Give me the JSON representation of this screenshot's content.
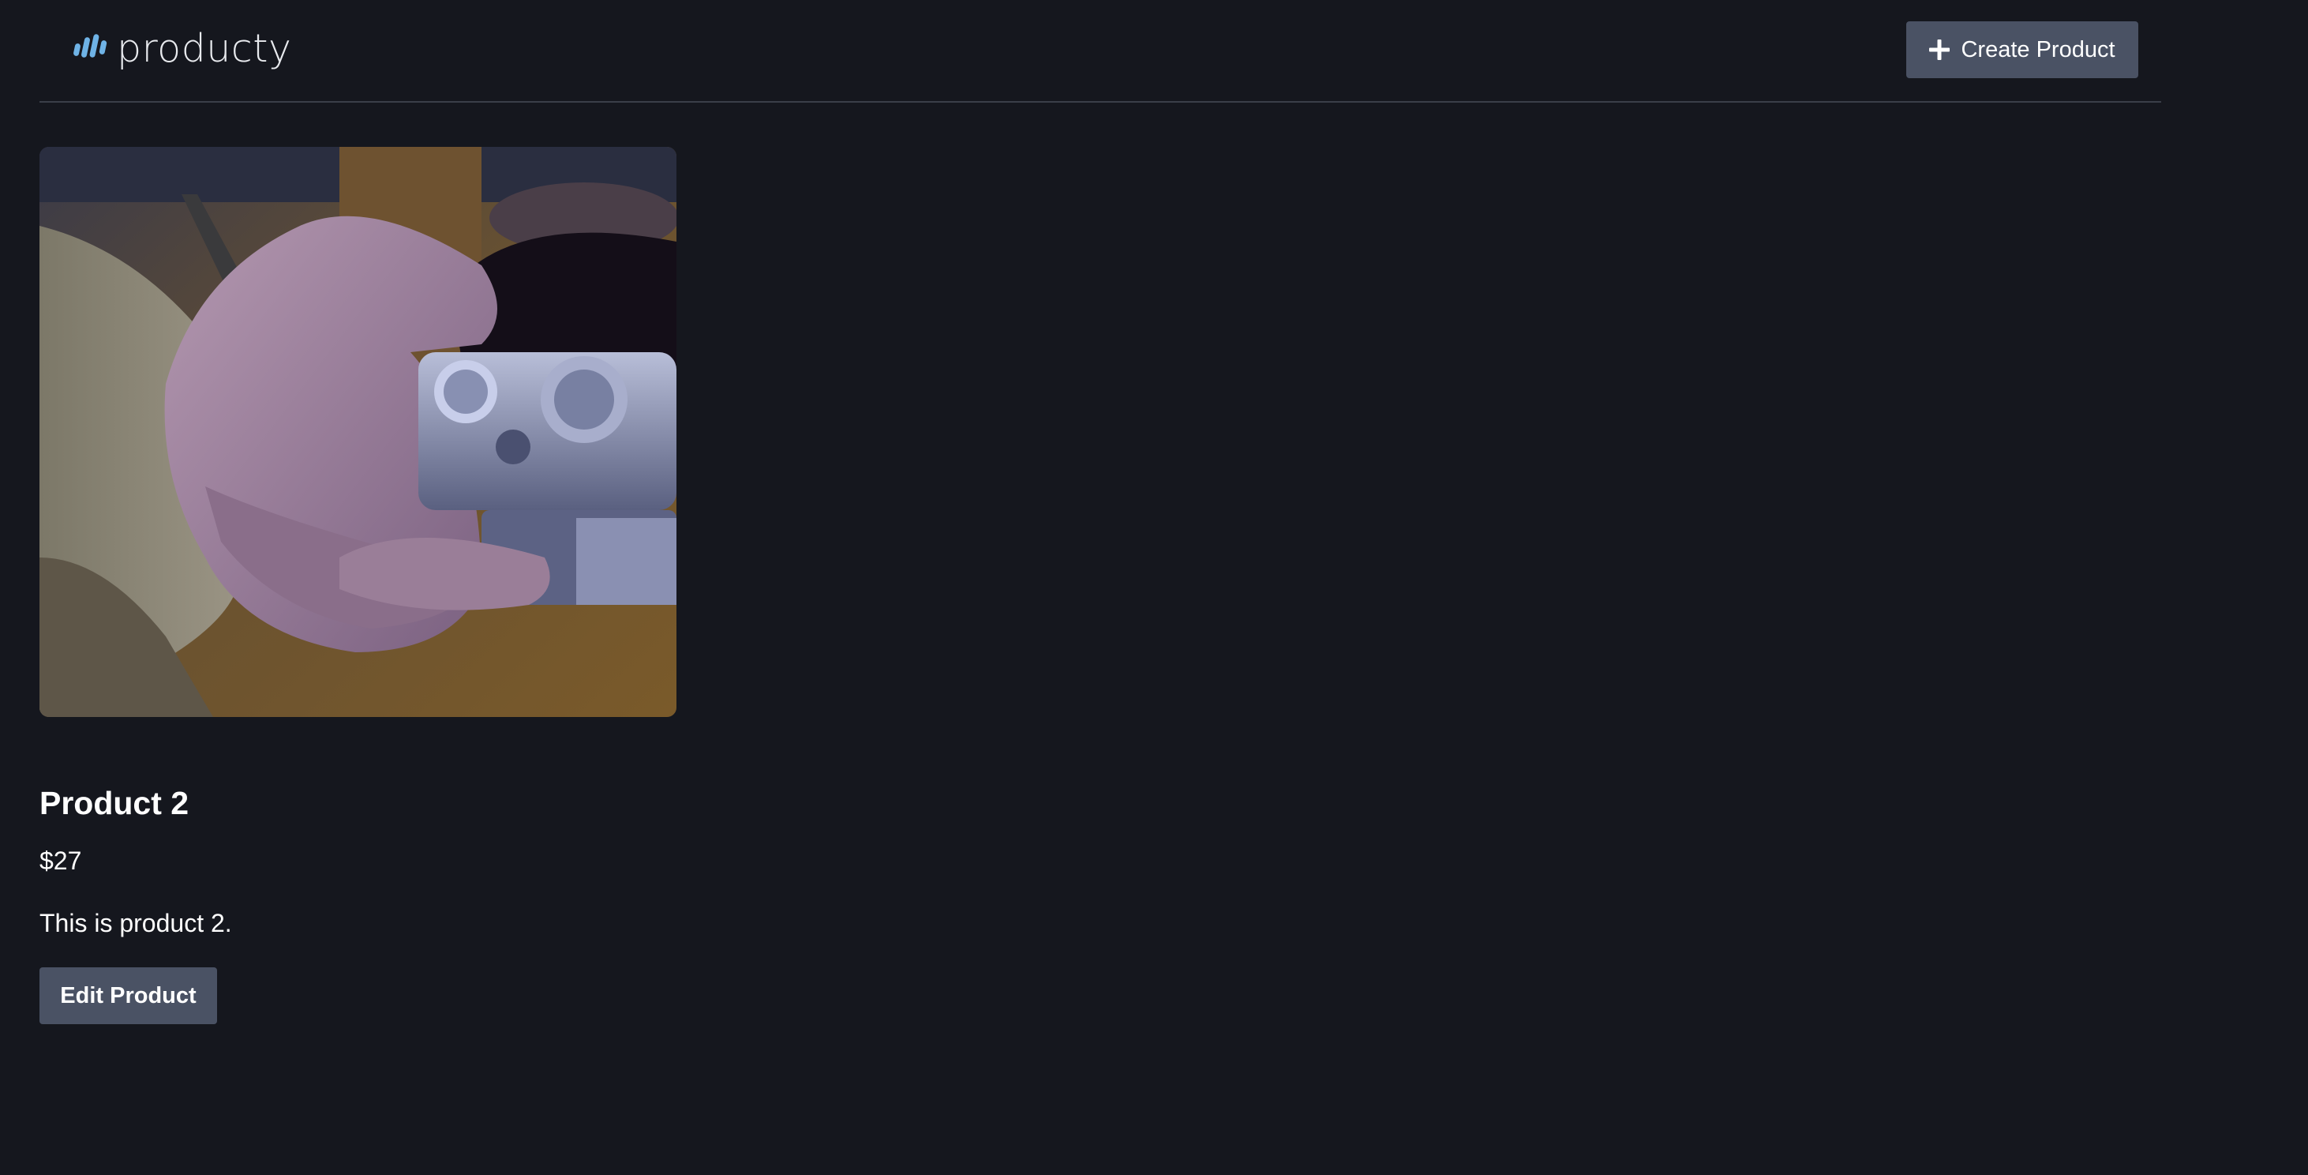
{
  "header": {
    "brand_name": "producty",
    "brand_color": "#6fb3e6",
    "create_button_label": "Create Product",
    "create_button_icon": "plus-icon"
  },
  "product": {
    "image_description_icon": "product-photo",
    "title": "Product 2",
    "price": "$27",
    "description": "This is product 2.",
    "edit_button_label": "Edit Product"
  },
  "colors": {
    "background": "#15171e",
    "button_bg": "#4a5264",
    "divider": "#3a3e48",
    "text": "#ffffff"
  }
}
